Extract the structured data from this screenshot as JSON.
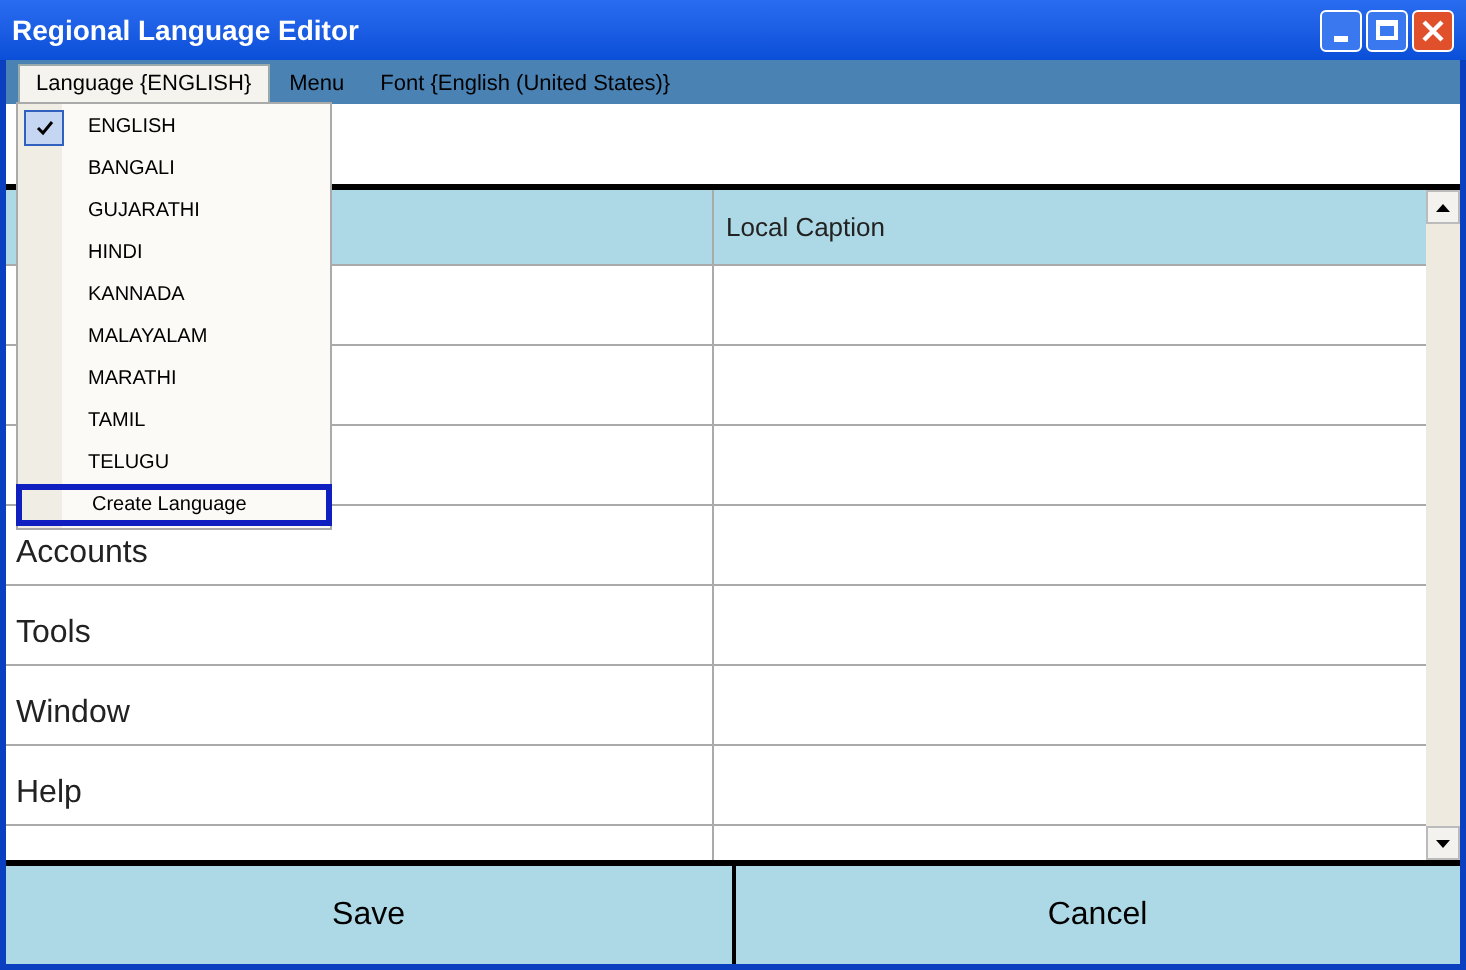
{
  "window": {
    "title": "Regional Language Editor"
  },
  "menu_bar": [
    {
      "label": "Language {ENGLISH}",
      "selected": true
    },
    {
      "label": "Menu",
      "selected": false
    },
    {
      "label": "Font {English (United States)}",
      "selected": false
    }
  ],
  "language_menu": [
    {
      "label": "ENGLISH",
      "checked": true,
      "selected": false
    },
    {
      "label": "BANGALI",
      "checked": false,
      "selected": false
    },
    {
      "label": "GUJARATHI",
      "checked": false,
      "selected": false
    },
    {
      "label": "HINDI",
      "checked": false,
      "selected": false
    },
    {
      "label": "KANNADA",
      "checked": false,
      "selected": false
    },
    {
      "label": "MALAYALAM",
      "checked": false,
      "selected": false
    },
    {
      "label": "MARATHI",
      "checked": false,
      "selected": false
    },
    {
      "label": "TAMIL",
      "checked": false,
      "selected": false
    },
    {
      "label": "TELUGU",
      "checked": false,
      "selected": false
    },
    {
      "label": "Create Language",
      "checked": false,
      "selected": true
    }
  ],
  "table": {
    "columns": [
      "Local Caption"
    ],
    "rows": [
      {
        "caption": "Accounts"
      },
      {
        "caption": "Tools"
      },
      {
        "caption": "Window"
      },
      {
        "caption": "Help"
      }
    ]
  },
  "buttons": [
    "Save",
    "Cancel"
  ]
}
